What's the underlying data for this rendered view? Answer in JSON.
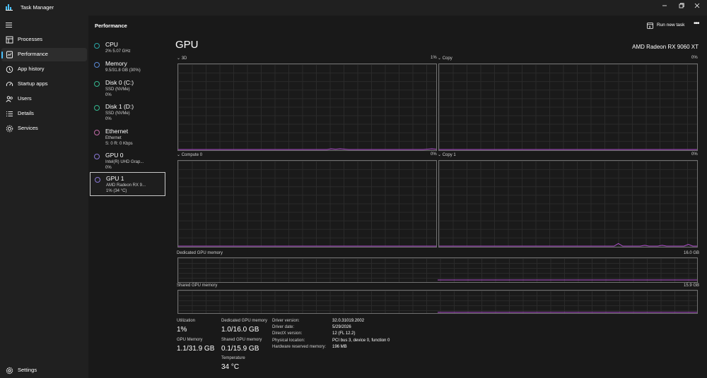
{
  "window": {
    "title": "Task Manager"
  },
  "nav": {
    "items": [
      {
        "label": "Processes",
        "icon": "processes-grid-icon"
      },
      {
        "label": "Performance",
        "icon": "performance-monitor-icon",
        "active": true
      },
      {
        "label": "App history",
        "icon": "history-clock-icon"
      },
      {
        "label": "Startup apps",
        "icon": "startup-speedometer-icon"
      },
      {
        "label": "Users",
        "icon": "users-icon"
      },
      {
        "label": "Details",
        "icon": "details-list-icon"
      },
      {
        "label": "Services",
        "icon": "services-puzzle-icon"
      }
    ],
    "settings": "Settings"
  },
  "header": {
    "title": "Performance",
    "run_task": "Run new task",
    "more": "•••"
  },
  "devices": [
    {
      "name": "CPU",
      "line1": "2% 5.07 GHz",
      "line2": "",
      "color": "#2aa6a6"
    },
    {
      "name": "Memory",
      "line1": "9.5/31.8 GB (30%)",
      "line2": "",
      "color": "#5a8ad6"
    },
    {
      "name": "Disk 0 (C:)",
      "line1": "SSD (NVMe)",
      "line2": "0%",
      "color": "#34b890"
    },
    {
      "name": "Disk 1 (D:)",
      "line1": "SSD (NVMe)",
      "line2": "0%",
      "color": "#34b890"
    },
    {
      "name": "Ethernet",
      "line1": "Ethernet",
      "line2": "S: 0 R: 0 Kbps",
      "color": "#c36ba8"
    },
    {
      "name": "GPU 0",
      "line1": "Intel(R) UHD Grap...",
      "line2": "0%",
      "color": "#8a78d6"
    },
    {
      "name": "GPU 1",
      "line1": "AMD Radeon RX 9...",
      "line2": "1% (34 °C)",
      "color": "#8a78d6",
      "selected": true
    }
  ],
  "gpu": {
    "title": "GPU",
    "model": "AMD Radeon RX 9060 XT",
    "engines": [
      {
        "name": "3D",
        "percent": "1%",
        "series": [
          0,
          0,
          0,
          0,
          0,
          0,
          0,
          0,
          0,
          0,
          0,
          0,
          0,
          0,
          0,
          0,
          0,
          0,
          0,
          0,
          0,
          0,
          0,
          0,
          0,
          0,
          0,
          0,
          0,
          0,
          0,
          0,
          0,
          0,
          0,
          0.8,
          0.3,
          0.8,
          0.4,
          0,
          0,
          0,
          0,
          0,
          0,
          0,
          0,
          0,
          0,
          0,
          0,
          0,
          0,
          0,
          0,
          0,
          0,
          0.4,
          0.8,
          0.4
        ]
      },
      {
        "name": "Copy",
        "percent": "0%",
        "series": [
          0,
          0,
          0,
          0,
          0,
          0,
          0,
          0,
          0,
          0,
          0,
          0,
          0,
          0,
          0,
          0,
          0,
          0,
          0,
          0,
          0,
          0,
          0,
          0,
          0,
          0,
          0,
          0,
          0,
          0,
          0,
          0,
          0,
          0,
          0,
          0,
          0,
          0,
          0,
          0,
          0,
          0,
          0,
          0,
          0,
          0,
          0,
          0,
          0,
          0,
          0,
          0,
          0,
          0,
          0,
          0,
          0,
          0,
          0,
          0
        ]
      },
      {
        "name": "Compute 0",
        "percent": "0%",
        "series": [
          0,
          0,
          0,
          0,
          0,
          0,
          0,
          0,
          0,
          0,
          0,
          0,
          0,
          0,
          0,
          0,
          0,
          0,
          0,
          0,
          0,
          0,
          0,
          0,
          0,
          0,
          0,
          0,
          0,
          0,
          0,
          0,
          0,
          0,
          0,
          0,
          0,
          0,
          0,
          0,
          0,
          0,
          0,
          0,
          0,
          0,
          0,
          0,
          0,
          0,
          0,
          0,
          0,
          0,
          0,
          0,
          0,
          0,
          0,
          0
        ]
      },
      {
        "name": "Copy 1",
        "percent": "0%",
        "series": [
          0,
          0,
          0,
          0,
          0,
          0,
          0,
          0,
          0,
          0,
          0,
          0,
          0,
          0,
          0,
          0,
          0,
          0,
          0,
          0,
          0,
          0,
          0,
          0,
          0,
          0,
          0,
          0,
          0,
          0,
          0,
          0,
          0,
          0,
          0,
          0,
          0,
          0,
          0,
          0,
          0,
          3,
          0,
          0,
          0,
          0,
          0,
          1,
          0,
          0,
          0,
          1,
          0,
          0,
          0,
          0,
          0,
          2,
          0,
          0
        ]
      }
    ],
    "dedicated_graph": {
      "label": "Dedicated GPU memory",
      "max": "16.0 GB",
      "fraction": 0.0625,
      "start": 0.5
    },
    "shared_graph": {
      "label": "Shared GPU memory",
      "max": "15.9 GB",
      "fraction": 0.006,
      "start": 0.5
    },
    "stats": {
      "utilization_label": "Utilization",
      "utilization": "1%",
      "gpu_memory_label": "GPU Memory",
      "gpu_memory": "1.1/31.9 GB",
      "dedicated_label": "Dedicated GPU memory",
      "dedicated": "1.0/16.0 GB",
      "shared_label": "Shared GPU memory",
      "shared": "0.1/15.9 GB",
      "temperature_label": "Temperature",
      "temperature": "34 °C"
    },
    "info": [
      {
        "key": "Driver version:",
        "value": "32.0.31019.2002"
      },
      {
        "key": "Driver date:",
        "value": "5/29/2026"
      },
      {
        "key": "DirectX version:",
        "value": "12 (FL 12.2)"
      },
      {
        "key": "Physical location:",
        "value": "PCI bus 3, device 0, function 0"
      },
      {
        "key": "Hardware reserved memory:",
        "value": "196 MB"
      }
    ]
  },
  "colors": {
    "accent": "#4cc2ff",
    "gpu_line": "#b24fd0",
    "grid": "#2a2a2a",
    "border": "#707070"
  }
}
